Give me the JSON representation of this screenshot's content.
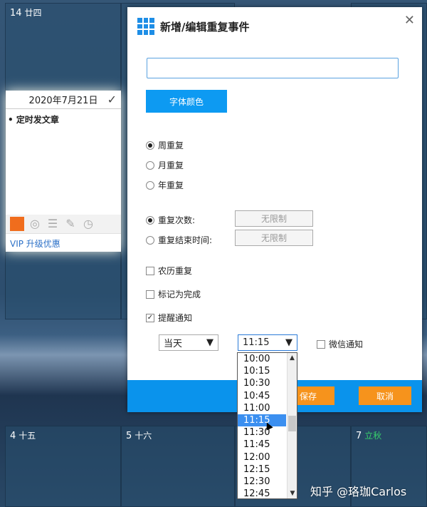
{
  "calendar": {
    "top_cells": [
      {
        "day": "14",
        "lunar": "廿四"
      },
      {
        "day": "",
        "lunar": ""
      },
      {
        "day": "",
        "lunar": ""
      }
    ],
    "bottom_cells": [
      {
        "day": "4",
        "lunar": "十五"
      },
      {
        "day": "5",
        "lunar": "十六"
      },
      {
        "day": "7",
        "lunar": "立秋"
      }
    ],
    "lunar_green_color": "#38d16c"
  },
  "note": {
    "date": "2020年7月21日",
    "content": "• 定时发文章",
    "color": "#f06d1d",
    "vip_text": "VIP  升级优惠"
  },
  "dialog": {
    "title": "新增/编辑重复事件",
    "title_input_value": "",
    "font_color_button": "字体颜色",
    "repeat_options": [
      {
        "label": "周重复",
        "checked": true
      },
      {
        "label": "月重复",
        "checked": false
      },
      {
        "label": "年重复",
        "checked": false
      }
    ],
    "repeat_count_label": "重复次数:",
    "repeat_count_value": "无限制",
    "repeat_end_label": "重复结束时间:",
    "repeat_end_value": "无限制",
    "lunar_repeat_label": "农历重复",
    "mark_done_label": "标记为完成",
    "remind_label": "提醒通知",
    "remind_day_value": "当天",
    "remind_time_value": "11:15",
    "wechat_label": "微信通知",
    "save_label": "保存",
    "cancel_label": "取消"
  },
  "time_dropdown": {
    "options": [
      "10:00",
      "10:15",
      "10:30",
      "10:45",
      "11:00",
      "11:15",
      "11:30",
      "11:45",
      "12:00",
      "12:15",
      "12:30",
      "12:45"
    ],
    "selected": "11:15"
  },
  "watermark": "知乎 @珞珈Carlos",
  "colors": {
    "accent_blue": "#0d9af2",
    "button_orange": "#f6931c"
  }
}
